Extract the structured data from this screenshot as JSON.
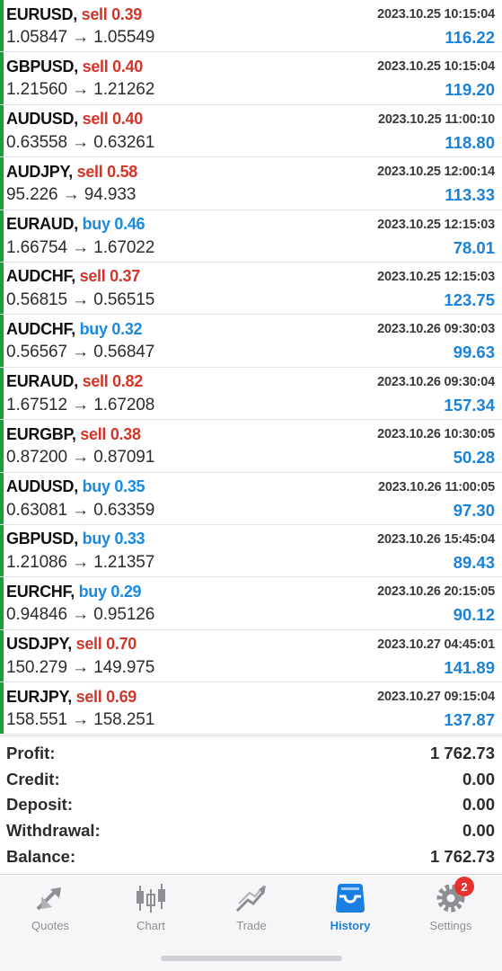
{
  "trades": [
    {
      "symbol": "EURUSD",
      "side": "sell",
      "volume": "0.39",
      "time": "2023.10.25 10:15:04",
      "prices": "1.05847 → 1.05549",
      "profit": "116.22"
    },
    {
      "symbol": "GBPUSD",
      "side": "sell",
      "volume": "0.40",
      "time": "2023.10.25 10:15:04",
      "prices": "1.21560 → 1.21262",
      "profit": "119.20"
    },
    {
      "symbol": "AUDUSD",
      "side": "sell",
      "volume": "0.40",
      "time": "2023.10.25 11:00:10",
      "prices": "0.63558 → 0.63261",
      "profit": "118.80"
    },
    {
      "symbol": "AUDJPY",
      "side": "sell",
      "volume": "0.58",
      "time": "2023.10.25 12:00:14",
      "prices": "95.226 → 94.933",
      "profit": "113.33"
    },
    {
      "symbol": "EURAUD",
      "side": "buy",
      "volume": "0.46",
      "time": "2023.10.25 12:15:03",
      "prices": "1.66754 → 1.67022",
      "profit": "78.01"
    },
    {
      "symbol": "AUDCHF",
      "side": "sell",
      "volume": "0.37",
      "time": "2023.10.25 12:15:03",
      "prices": "0.56815 → 0.56515",
      "profit": "123.75"
    },
    {
      "symbol": "AUDCHF",
      "side": "buy",
      "volume": "0.32",
      "time": "2023.10.26 09:30:03",
      "prices": "0.56567 → 0.56847",
      "profit": "99.63"
    },
    {
      "symbol": "EURAUD",
      "side": "sell",
      "volume": "0.82",
      "time": "2023.10.26 09:30:04",
      "prices": "1.67512 → 1.67208",
      "profit": "157.34"
    },
    {
      "symbol": "EURGBP",
      "side": "sell",
      "volume": "0.38",
      "time": "2023.10.26 10:30:05",
      "prices": "0.87200 → 0.87091",
      "profit": "50.28"
    },
    {
      "symbol": "AUDUSD",
      "side": "buy",
      "volume": "0.35",
      "time": "2023.10.26 11:00:05",
      "prices": "0.63081 → 0.63359",
      "profit": "97.30"
    },
    {
      "symbol": "GBPUSD",
      "side": "buy",
      "volume": "0.33",
      "time": "2023.10.26 15:45:04",
      "prices": "1.21086 → 1.21357",
      "profit": "89.43"
    },
    {
      "symbol": "EURCHF",
      "side": "buy",
      "volume": "0.29",
      "time": "2023.10.26 20:15:05",
      "prices": "0.94846 → 0.95126",
      "profit": "90.12"
    },
    {
      "symbol": "USDJPY",
      "side": "sell",
      "volume": "0.70",
      "time": "2023.10.27 04:45:01",
      "prices": "150.279 → 149.975",
      "profit": "141.89"
    },
    {
      "symbol": "EURJPY",
      "side": "sell",
      "volume": "0.69",
      "time": "2023.10.27 09:15:04",
      "prices": "158.551 → 158.251",
      "profit": "137.87"
    }
  ],
  "summary": {
    "profit_label": "Profit:",
    "profit_value": "1 762.73",
    "credit_label": "Credit:",
    "credit_value": "0.00",
    "deposit_label": "Deposit:",
    "deposit_value": "0.00",
    "withdrawal_label": "Withdrawal:",
    "withdrawal_value": "0.00",
    "balance_label": "Balance:",
    "balance_value": "1 762.73"
  },
  "tabs": [
    {
      "label": "Quotes",
      "icon": "quotes-icon",
      "active": false
    },
    {
      "label": "Chart",
      "icon": "chart-icon",
      "active": false
    },
    {
      "label": "Trade",
      "icon": "trade-icon",
      "active": false
    },
    {
      "label": "History",
      "icon": "history-icon",
      "active": true
    },
    {
      "label": "Settings",
      "icon": "settings-icon",
      "active": false,
      "badge": "2"
    }
  ],
  "colors": {
    "sell": "#d2362a",
    "buy": "#1a8ae0",
    "profit": "#1a82d8",
    "active_tab": "#1a7fe0",
    "row_marker": "#1f9d3a",
    "badge": "#e5322f"
  }
}
